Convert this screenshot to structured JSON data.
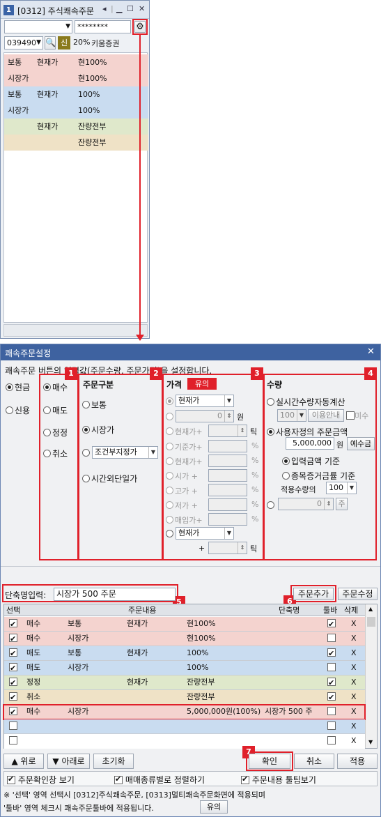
{
  "colors": {
    "accent": "#e0202a",
    "sell": "#c9dcf0",
    "buy": "#f4d3cf",
    "modify": "#dfe8cb",
    "cancel": "#efe2c6"
  },
  "order_window": {
    "num": "1",
    "title": "[0312] 주식쾌속주문",
    "password": "********",
    "code": "039490",
    "credit_badge": "신",
    "margin": "20%",
    "name": "키움증권",
    "rows": [
      {
        "a": "보통",
        "b": "현재가",
        "c": "현100%"
      },
      {
        "a": "시장가",
        "b": "",
        "c": "현100%"
      },
      {
        "a": "보통",
        "b": "현재가",
        "c": "100%"
      },
      {
        "a": "시장가",
        "b": "",
        "c": "100%"
      },
      {
        "a": "",
        "b": "현재가",
        "c": "잔량전부"
      },
      {
        "a": "",
        "b": "",
        "c": "잔량전부"
      }
    ]
  },
  "dialog": {
    "title": "쾌속주문설정",
    "description": "쾌속주문 버튼의 입력값(주문수량, 주문가격)을 설정합니다.",
    "account_type": [
      "현금",
      "신용"
    ],
    "trade_type": [
      "매수",
      "매도",
      "정정",
      "취소"
    ],
    "order_type_header": "주문구분",
    "order_types": [
      "보통",
      "시장가",
      "시간외단일가"
    ],
    "condition_select": "조건부지정가",
    "price_header": "가격",
    "price_notice": "유의",
    "price_select": "현재가",
    "price_value": "0",
    "won": "원",
    "price_rows": [
      "현재가+",
      "기준가+",
      "현재가+",
      "시가 +",
      "고가 +",
      "저가 +",
      "매입가+"
    ],
    "tick": "틱",
    "pct": "%",
    "price_bottom_select": "현재가",
    "plus": "+",
    "qty_header": "수량",
    "qty_auto": "실시간수량자동계산",
    "qty_auto_val": "100",
    "qty_info_btn": "이용안내",
    "qty_miss": "미수",
    "qty_user": "사용자정의 주문금액",
    "qty_amount": "5,000,000",
    "qty_deposit_btn": "예수금",
    "qty_basis1": "입력금액 기준",
    "qty_basis2": "종목증거금률 기준",
    "qty_apply_label": "적용수량의",
    "qty_apply_val": "100",
    "qty_direct_val": "0",
    "qty_unit": "주",
    "shortname_label": "단축명입력:",
    "shortname_value": "시장가 500 주문",
    "add_btn": "주문추가",
    "edit_btn": "주문수정",
    "table_headers": [
      "선택",
      "주문내용",
      "단축명",
      "툴바",
      "삭제"
    ],
    "table_rows": [
      {
        "sel": true,
        "t": "매수",
        "o": "보통",
        "p": "현재가",
        "q": "현100%",
        "s": "",
        "bar": true
      },
      {
        "sel": true,
        "t": "매수",
        "o": "시장가",
        "p": "",
        "q": "현100%",
        "s": "",
        "bar": false
      },
      {
        "sel": true,
        "t": "매도",
        "o": "보통",
        "p": "현재가",
        "q": "100%",
        "s": "",
        "bar": true
      },
      {
        "sel": true,
        "t": "매도",
        "o": "시장가",
        "p": "",
        "q": "100%",
        "s": "",
        "bar": false
      },
      {
        "sel": true,
        "t": "정정",
        "o": "",
        "p": "현재가",
        "q": "잔량전부",
        "s": "",
        "bar": true
      },
      {
        "sel": true,
        "t": "취소",
        "o": "",
        "p": "",
        "q": "잔량전부",
        "s": "",
        "bar": true
      },
      {
        "sel": true,
        "t": "매수",
        "o": "시장가",
        "p": "",
        "q": "5,000,000원(100%)",
        "s": "시장가 500 주",
        "bar": false
      }
    ],
    "delete_mark": "X",
    "up_btn": "▲ 위로",
    "down_btn": "▼ 아래로",
    "reset_btn": "초기화",
    "ok_btn": "확인",
    "cancel_btn": "취소",
    "apply_btn": "적용",
    "opt1": "주문확인창 보기",
    "opt2": "매매종류별로 정렬하기",
    "opt3": "주문내용 툴팁보기",
    "note1": "※ '선택' 영역 선택시 [0312]주식쾌속주문, [0313]멀티쾌속주문화면에 적용되며",
    "note2": "'툴바' 영역 체크시 쾌속주문툴바에 적용됩니다.",
    "note_btn": "유의",
    "badges": [
      "1",
      "2",
      "3",
      "4",
      "5",
      "6",
      "7"
    ]
  }
}
